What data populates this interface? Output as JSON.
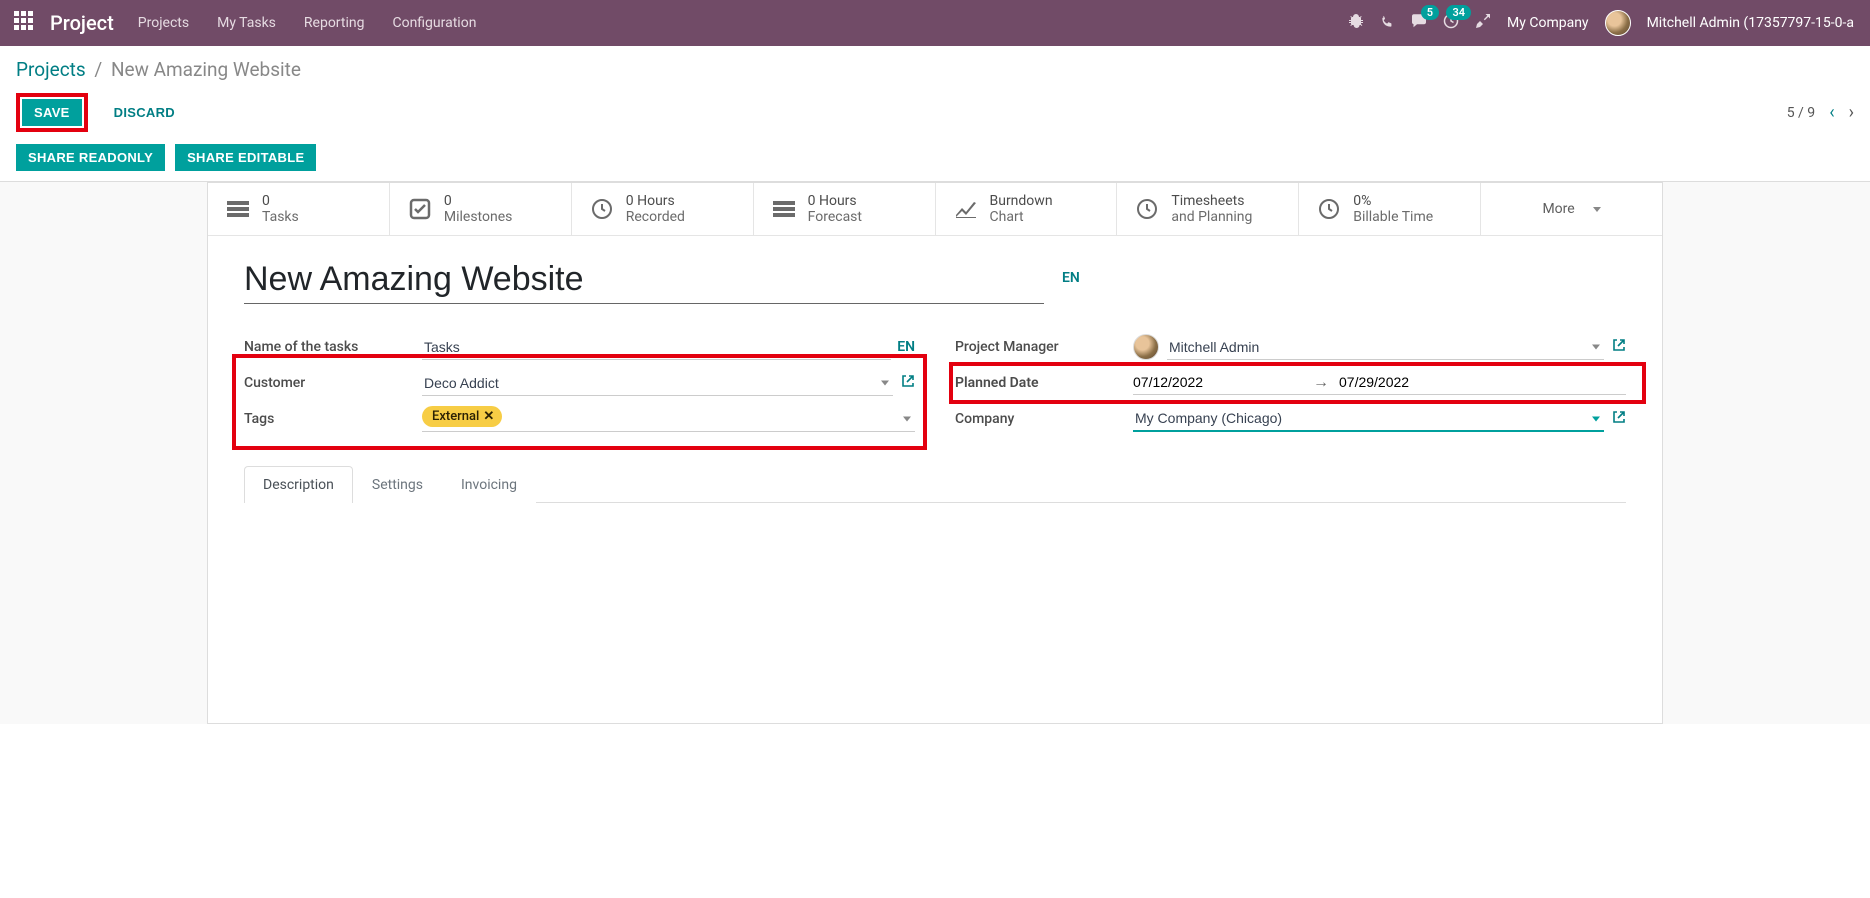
{
  "topnav": {
    "brand": "Project",
    "menu": [
      "Projects",
      "My Tasks",
      "Reporting",
      "Configuration"
    ],
    "messages_count": "5",
    "activities_count": "34",
    "company": "My Company",
    "user": "Mitchell Admin (17357797-15-0-a"
  },
  "breadcrumb": {
    "root": "Projects",
    "current": "New Amazing Website"
  },
  "buttons": {
    "save": "Save",
    "discard": "Discard",
    "share_readonly": "Share Readonly",
    "share_editable": "Share Editable"
  },
  "pager": {
    "text": "5 / 9"
  },
  "stats": [
    {
      "line1": "0",
      "line2": "Tasks"
    },
    {
      "line1": "0",
      "line2": "Milestones"
    },
    {
      "line1": "0 Hours",
      "line2": "Recorded"
    },
    {
      "line1": "0 Hours",
      "line2": "Forecast"
    },
    {
      "line1": "Burndown",
      "line2": "Chart"
    },
    {
      "line1": "Timesheets",
      "line2": "and Planning"
    },
    {
      "line1": "0%",
      "line2": "Billable Time"
    }
  ],
  "more_label": "More",
  "title": "New Amazing Website",
  "lang": "EN",
  "fields": {
    "tasks_label": "Name of the tasks",
    "tasks_value": "Tasks",
    "customer_label": "Customer",
    "customer_value": "Deco Addict",
    "tags_label": "Tags",
    "tag_value": "External",
    "pm_label": "Project Manager",
    "pm_value": "Mitchell Admin",
    "planned_label": "Planned Date",
    "date_start": "07/12/2022",
    "date_end": "07/29/2022",
    "company_label": "Company",
    "company_value": "My Company (Chicago)"
  },
  "tabs": [
    "Description",
    "Settings",
    "Invoicing"
  ]
}
